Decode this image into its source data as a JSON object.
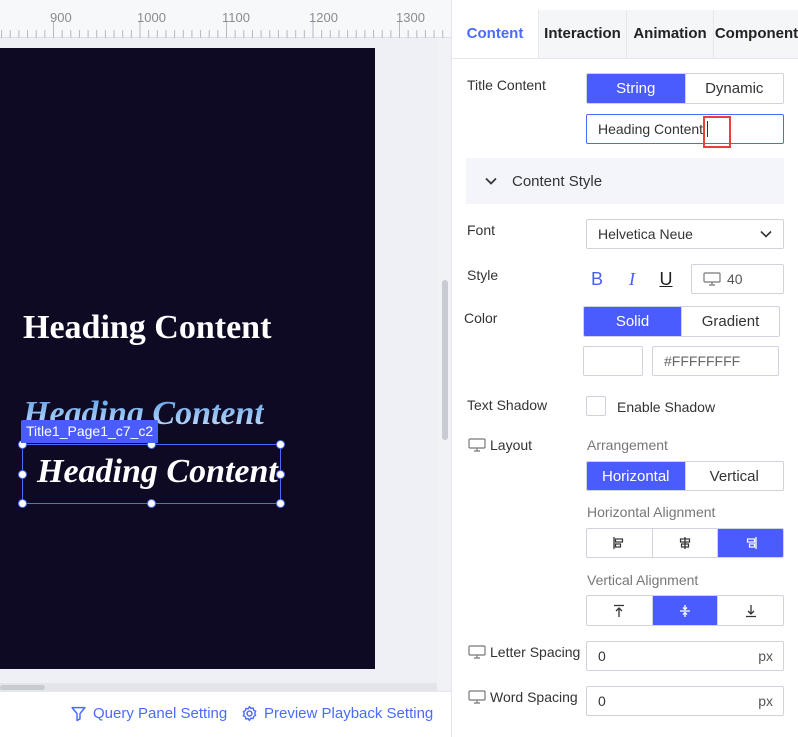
{
  "ruler": {
    "labels": [
      "900",
      "1000",
      "1100",
      "1200",
      "1300"
    ]
  },
  "canvas": {
    "headings": [
      "Heading Content",
      "Heading Content",
      "Heading Content"
    ],
    "selected_component": "Title1_Page1_c7_c2"
  },
  "bottom_bar": {
    "query_panel": "Query Panel Setting",
    "preview_playback": "Preview Playback Setting"
  },
  "panel": {
    "tabs": [
      "Content",
      "Interaction",
      "Animation",
      "Component"
    ],
    "active_tab": "Content",
    "title_content": {
      "label": "Title Content",
      "modes": [
        "String",
        "Dynamic"
      ],
      "active_mode": "String",
      "value": "Heading Content"
    },
    "content_style": {
      "label": "Content Style"
    },
    "font": {
      "label": "Font",
      "value": "Helvetica Neue"
    },
    "style": {
      "label": "Style",
      "bold": "B",
      "italic": "I",
      "underline": "U",
      "size": "40"
    },
    "color": {
      "label": "Color",
      "modes": [
        "Solid",
        "Gradient"
      ],
      "active_mode": "Solid",
      "hex": "#FFFFFFFF",
      "swatch": "#FFFFFF"
    },
    "text_shadow": {
      "label": "Text Shadow",
      "checkbox_label": "Enable Shadow"
    },
    "layout": {
      "label": "Layout",
      "arrangement_label": "Arrangement",
      "arrangement_modes": [
        "Horizontal",
        "Vertical"
      ],
      "h_align_label": "Horizontal Alignment",
      "v_align_label": "Vertical Alignment"
    },
    "letter_spacing": {
      "label": "Letter Spacing",
      "value": "0",
      "unit": "px"
    },
    "word_spacing": {
      "label": "Word Spacing",
      "value": "0",
      "unit": "px"
    }
  },
  "colors": {
    "accent": "#4B5CFF",
    "canvas_bg": "#0E0A24",
    "highlight": "#E8413A"
  }
}
